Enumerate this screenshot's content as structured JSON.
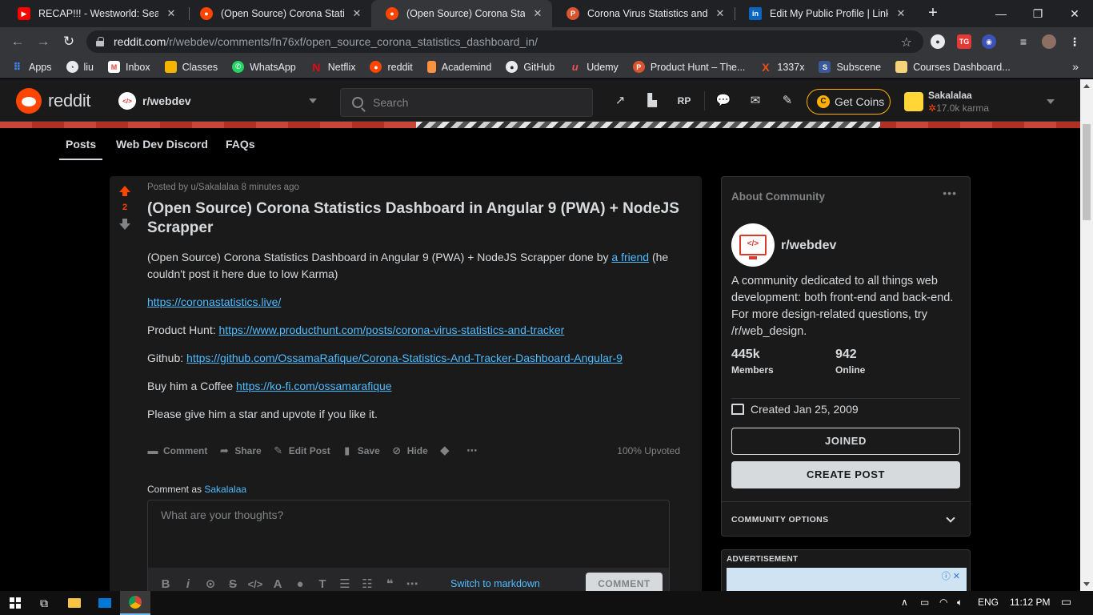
{
  "browser": {
    "tabs": [
      {
        "title": "RECAP!!! - Westworld: Season",
        "favicon": "youtube-icon",
        "color": "#ff0000"
      },
      {
        "title": "(Open Source) Corona Statistic",
        "favicon": "reddit-icon",
        "color": "#ff4500"
      },
      {
        "title": "(Open Source) Corona Statistic",
        "favicon": "reddit-icon",
        "color": "#ff4500"
      },
      {
        "title": "Corona Virus Statistics and Tra",
        "favicon": "producthunt-icon",
        "color": "#da552f",
        "glyph": "P"
      },
      {
        "title": "Edit My Public Profile | LinkedI",
        "favicon": "linkedin-icon",
        "color": "#0a66c2",
        "glyph": "in"
      }
    ],
    "url_host": "reddit.com",
    "url_path": "/r/webdev/comments/fn76xf/open_source_corona_statistics_dashboard_in/",
    "bookmarks": [
      {
        "label": "Apps",
        "icon": "apps-grid-icon",
        "color": "#4285f4"
      },
      {
        "label": "liu",
        "icon": "globe-icon",
        "color": "#5f6368"
      },
      {
        "label": "Inbox",
        "icon": "gmail-icon",
        "color": "#ea4335",
        "glyph": "M"
      },
      {
        "label": "Classes",
        "icon": "classroom-icon",
        "color": "#f4b400"
      },
      {
        "label": "WhatsApp",
        "icon": "whatsapp-icon",
        "color": "#25d366"
      },
      {
        "label": "Netflix",
        "icon": "netflix-icon",
        "color": "#e50914",
        "glyph": "N"
      },
      {
        "label": "reddit",
        "icon": "reddit-icon",
        "color": "#ff4500"
      },
      {
        "label": "Academind",
        "icon": "bookmark-icon",
        "color": "#fa923f"
      },
      {
        "label": "GitHub",
        "icon": "github-icon",
        "color": "#24292e"
      },
      {
        "label": "Udemy",
        "icon": "udemy-icon",
        "color": "#a435f0",
        "glyph": "u"
      },
      {
        "label": "Product Hunt – The...",
        "icon": "producthunt-icon",
        "color": "#da552f",
        "glyph": "P"
      },
      {
        "label": "1337x",
        "icon": "x-icon",
        "color": "#f14e13",
        "glyph": "X"
      },
      {
        "label": "Subscene",
        "icon": "subscene-icon",
        "color": "#3b5998",
        "glyph": "S"
      },
      {
        "label": "Courses Dashboard...",
        "icon": "folder-icon",
        "color": "#f6d37a"
      }
    ],
    "bookmarks_more": "»"
  },
  "reddit": {
    "wordmark": "reddit",
    "subreddit": "r/webdev",
    "search_placeholder": "Search",
    "coins_label": "Get Coins",
    "username": "Sakalalaa",
    "karma": "17.0k karma",
    "subnav": [
      "Posts",
      "Web Dev Discord",
      "FAQs"
    ]
  },
  "post": {
    "votes": "2",
    "meta": "Posted by u/Sakalalaa 8 minutes ago",
    "title": "(Open Source) Corona Statistics Dashboard in Angular 9 (PWA) + NodeJS Scrapper",
    "p1_before": "(Open Source) Corona Statistics Dashboard in Angular 9 (PWA) + NodeJS Scrapper done by ",
    "p1_link": "a friend",
    "p1_after": " (he couldn't post it here due to low Karma)",
    "p2_link": "https://coronastatistics.live/",
    "p3_label": "Product Hunt: ",
    "p3_link": "https://www.producthunt.com/posts/corona-virus-statistics-and-tracker",
    "p4_label": "Github: ",
    "p4_link": "https://github.com/OssamaRafique/Corona-Statistics-And-Tracker-Dashboard-Angular-9",
    "p5_label": "Buy him a Coffee ",
    "p5_link": "https://ko-fi.com/ossamarafique",
    "p6": "Please give him a star and upvote if you like it.",
    "actions": {
      "comment": "Comment",
      "share": "Share",
      "edit": "Edit Post",
      "save": "Save",
      "hide": "Hide"
    },
    "upvoted": "100% Upvoted",
    "comment_as": "Comment as ",
    "comment_user": "Sakalalaa",
    "comment_placeholder": "What are your thoughts?",
    "switch_markdown": "Switch to markdown",
    "comment_button": "COMMENT"
  },
  "sidebar": {
    "header": "About Community",
    "name": "r/webdev",
    "description": "A community dedicated to all things web development: both front-end and back-end. For more design-related questions, try /r/web_design.",
    "members_value": "445k",
    "members_label": "Members",
    "online_value": "942",
    "online_label": "Online",
    "created": "Created Jan 25, 2009",
    "joined_button": "JOINED",
    "create_post_button": "CREATE POST",
    "community_options": "COMMUNITY OPTIONS",
    "advertisement": "ADVERTISEMENT"
  },
  "taskbar": {
    "lang": "ENG",
    "time": "11:12 PM"
  }
}
